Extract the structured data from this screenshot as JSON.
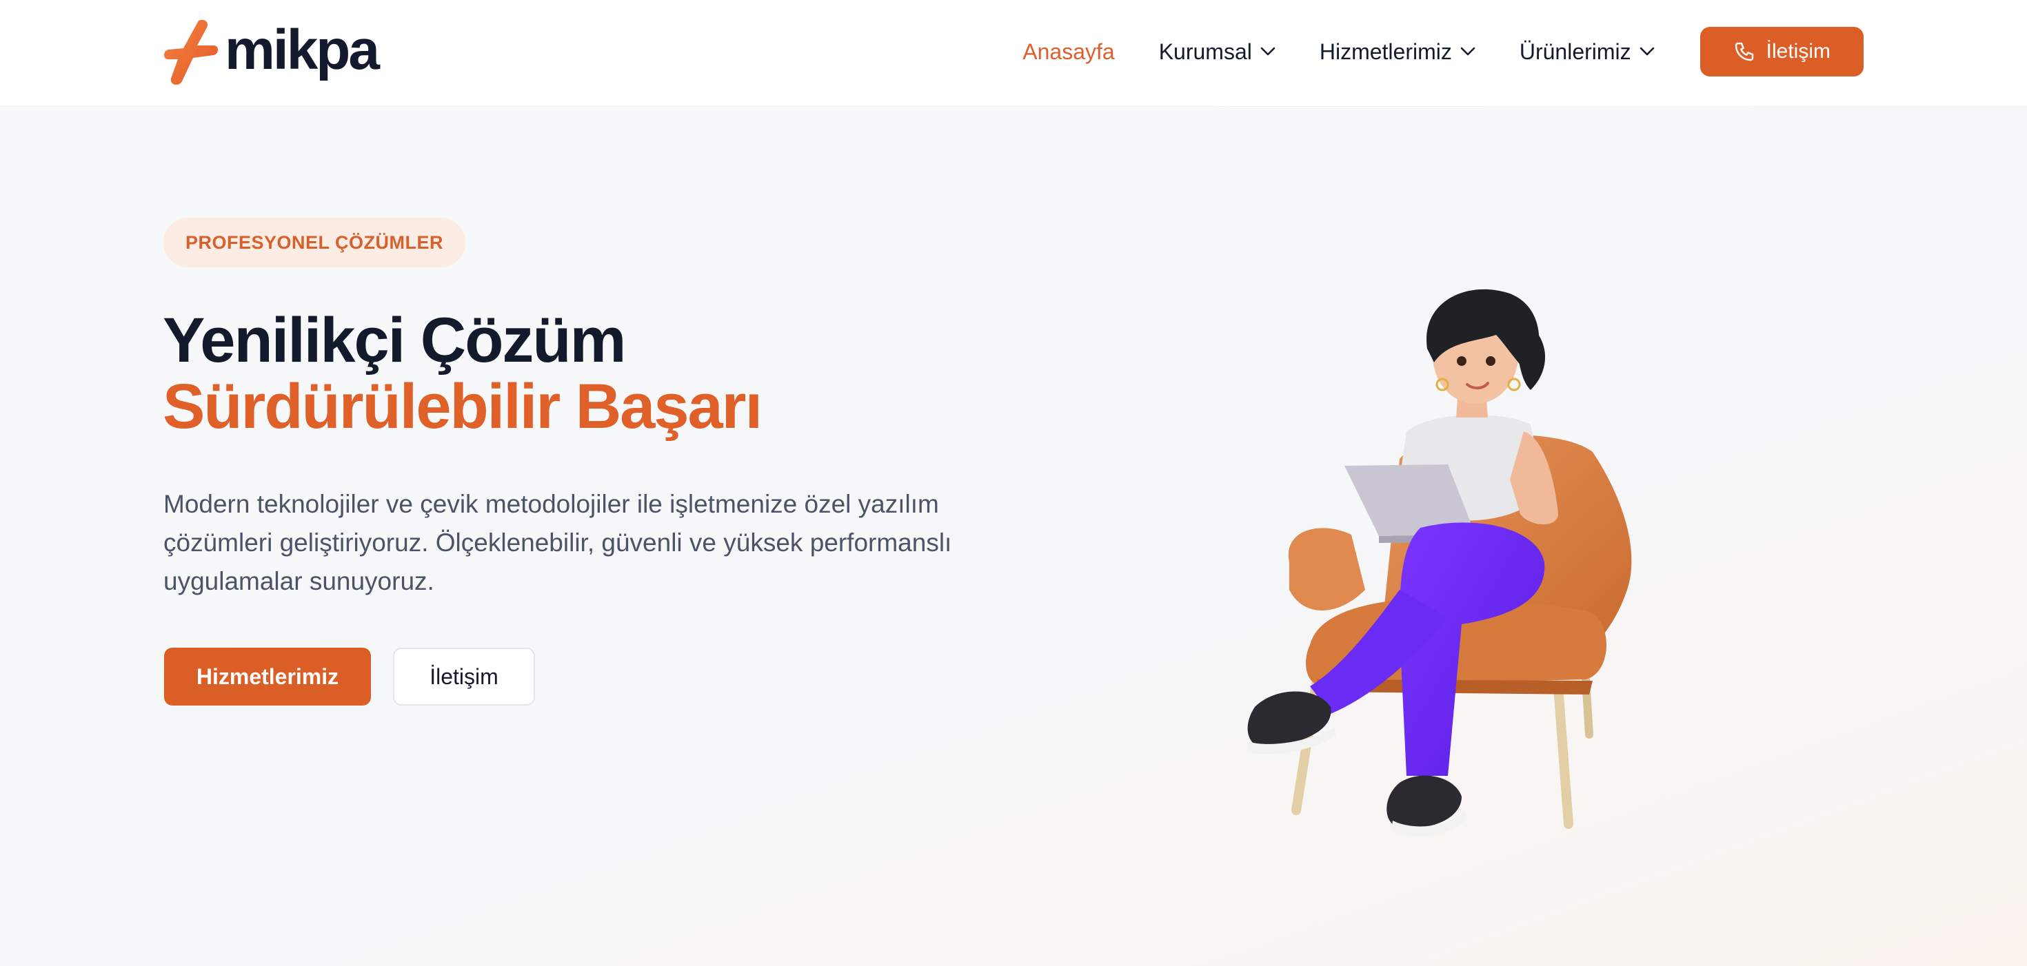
{
  "header": {
    "logo_text": "mikpa",
    "nav": [
      {
        "label": "Anasayfa",
        "active": true
      },
      {
        "label": "Kurumsal",
        "dropdown": true
      },
      {
        "label": "Hizmetlerimiz",
        "dropdown": true
      },
      {
        "label": "Ürünlerimiz",
        "dropdown": true
      }
    ],
    "cta_label": "İletişim"
  },
  "hero": {
    "badge": "PROFESYONEL ÇÖZÜMLER",
    "title_line1": "Yenilikçi Çözüm",
    "title_line2": "Sürdürülebilir Başarı",
    "description": "Modern teknolojiler ve çevik metodolojiler ile işletmenize özel yazılım çözümleri geliştiriyoruz. Ölçeklenebilir, güvenli ve yüksek performanslı uygulamalar sunuyoruz.",
    "primary_button": "Hizmetlerimiz",
    "secondary_button": "İletişim"
  },
  "icons": {
    "logo": "mikpa-logo-icon",
    "chevron": "chevron-down-icon",
    "phone": "phone-icon",
    "illustration": "woman-with-laptop-in-armchair-illustration"
  },
  "colors": {
    "accent": "#dc5e27",
    "text_dark": "#131a2b",
    "badge_bg": "#fbece4"
  }
}
